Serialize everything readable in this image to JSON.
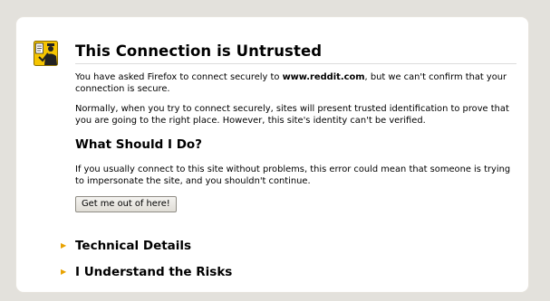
{
  "page": {
    "title": "This Connection is Untrusted",
    "intro_before": "You have asked Firefox to connect securely to ",
    "intro_site": "www.reddit.com",
    "intro_after": ", but we can't confirm that your connection is secure.",
    "explanation": "Normally, when you try to connect securely, sites will present trusted identification to prove that you are going to the right place. However, this site's identity can't be verified.",
    "what_to_do_heading": "What Should I Do?",
    "what_to_do_text": "If you usually connect to this site without problems, this error could mean that someone is trying to impersonate the site, and you shouldn't continue.",
    "get_out_button": "Get me out of here!",
    "technical_details": "Technical Details",
    "understand_risks": "I Understand the Risks"
  },
  "icons": {
    "warning": "security-officer-warning-icon",
    "expander": "triangle-right-icon"
  },
  "colors": {
    "page_background": "#e3e1dc",
    "card_background": "#ffffff",
    "icon_yellow": "#f5c400",
    "expander_arrow": "#e8a200"
  }
}
